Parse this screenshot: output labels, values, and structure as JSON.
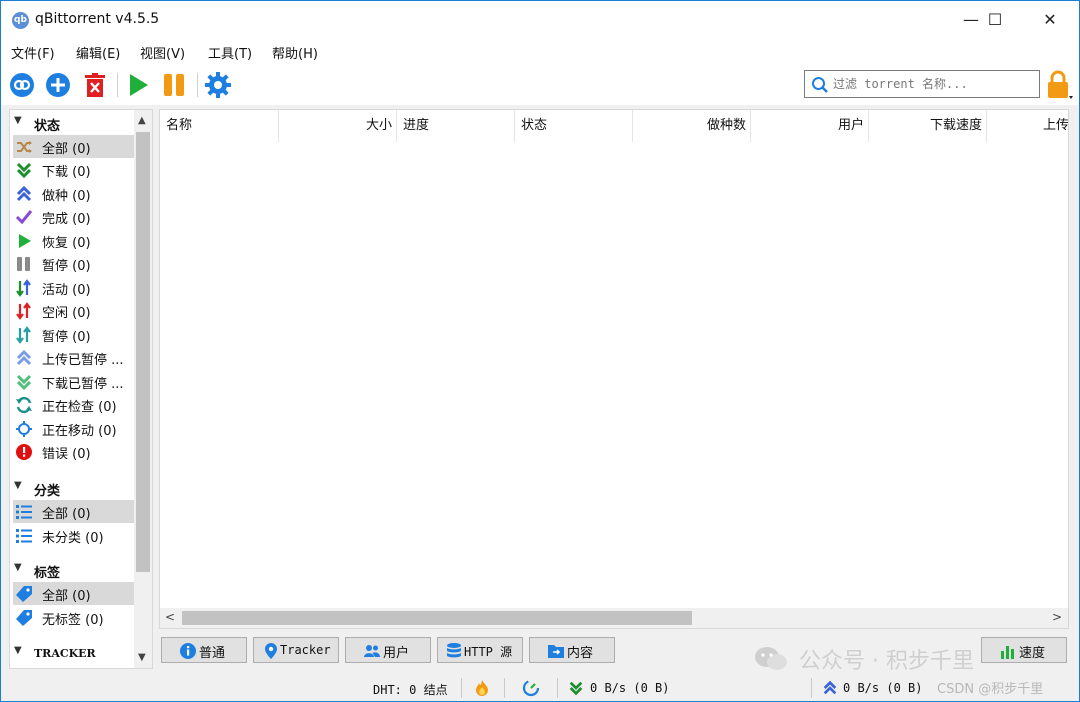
{
  "window": {
    "app_icon_text": "qb",
    "title": "qBittorrent v4.5.5",
    "minimize": "—",
    "maximize": "☐",
    "close": "✕"
  },
  "menu": [
    "文件(F)",
    "编辑(E)",
    "视图(V)",
    "工具(T)",
    "帮助(H)"
  ],
  "toolbar": {
    "buttons": [
      "add-link-icon",
      "add-torrent-icon",
      "delete-icon",
      "resume-icon",
      "pause-icon",
      "settings-icon"
    ],
    "search_placeholder": "过滤 torrent 名称...",
    "lock_icon": "lock-icon"
  },
  "sidebar": {
    "status_header": "状态",
    "status_items": [
      {
        "label": "全部 (0)",
        "icon": "shuffle-icon",
        "selected": true
      },
      {
        "label": "下载 (0)",
        "icon": "double-chevron-down-icon"
      },
      {
        "label": "做种 (0)",
        "icon": "double-chevron-up-icon"
      },
      {
        "label": "完成 (0)",
        "icon": "checkmark-icon"
      },
      {
        "label": "恢复 (0)",
        "icon": "play-icon"
      },
      {
        "label": "暂停 (0)",
        "icon": "pause-icon"
      },
      {
        "label": "活动 (0)",
        "icon": "up-down-arrows-icon"
      },
      {
        "label": "空闲 (0)",
        "icon": "up-down-arrows-red-icon"
      },
      {
        "label": "暂停 (0)",
        "icon": "up-down-arrows-teal-icon"
      },
      {
        "label": "上传已暂停 ...",
        "icon": "double-chevron-up-light-icon"
      },
      {
        "label": "下载已暂停 ...",
        "icon": "double-chevron-down-light-icon"
      },
      {
        "label": "正在检查 (0)",
        "icon": "refresh-icon"
      },
      {
        "label": "正在移动 (0)",
        "icon": "crosshair-icon"
      },
      {
        "label": "错误 (0)",
        "icon": "error-icon"
      }
    ],
    "category_header": "分类",
    "category_items": [
      {
        "label": "全部 (0)",
        "icon": "list-icon",
        "selected": true
      },
      {
        "label": "未分类 (0)",
        "icon": "list-icon"
      }
    ],
    "tags_header": "标签",
    "tag_items": [
      {
        "label": "全部 (0)",
        "icon": "tag-icon",
        "selected": true
      },
      {
        "label": "无标签 (0)",
        "icon": "tag-icon"
      }
    ],
    "tracker_header": "TRACKER"
  },
  "columns": [
    "名称",
    "大小",
    "进度",
    "状态",
    "做种数",
    "用户",
    "下载速度",
    "上传"
  ],
  "bottom_tabs": [
    {
      "label": "普通",
      "icon": "info-icon"
    },
    {
      "label": "Tracker",
      "icon": "location-pin-icon"
    },
    {
      "label": "用户",
      "icon": "users-icon"
    },
    {
      "label": "HTTP 源",
      "icon": "database-icon"
    },
    {
      "label": "内容",
      "icon": "folder-icon"
    }
  ],
  "speed_button": {
    "label": "速度",
    "icon": "bar-chart-icon"
  },
  "statusbar": {
    "dht": "DHT: 0 结点",
    "download": "0 B/s (0 B)",
    "upload": "0 B/s (0 B)"
  },
  "watermark": {
    "wechat": "公众号 · 积步千里",
    "csdn": "CSDN @积步千里"
  }
}
